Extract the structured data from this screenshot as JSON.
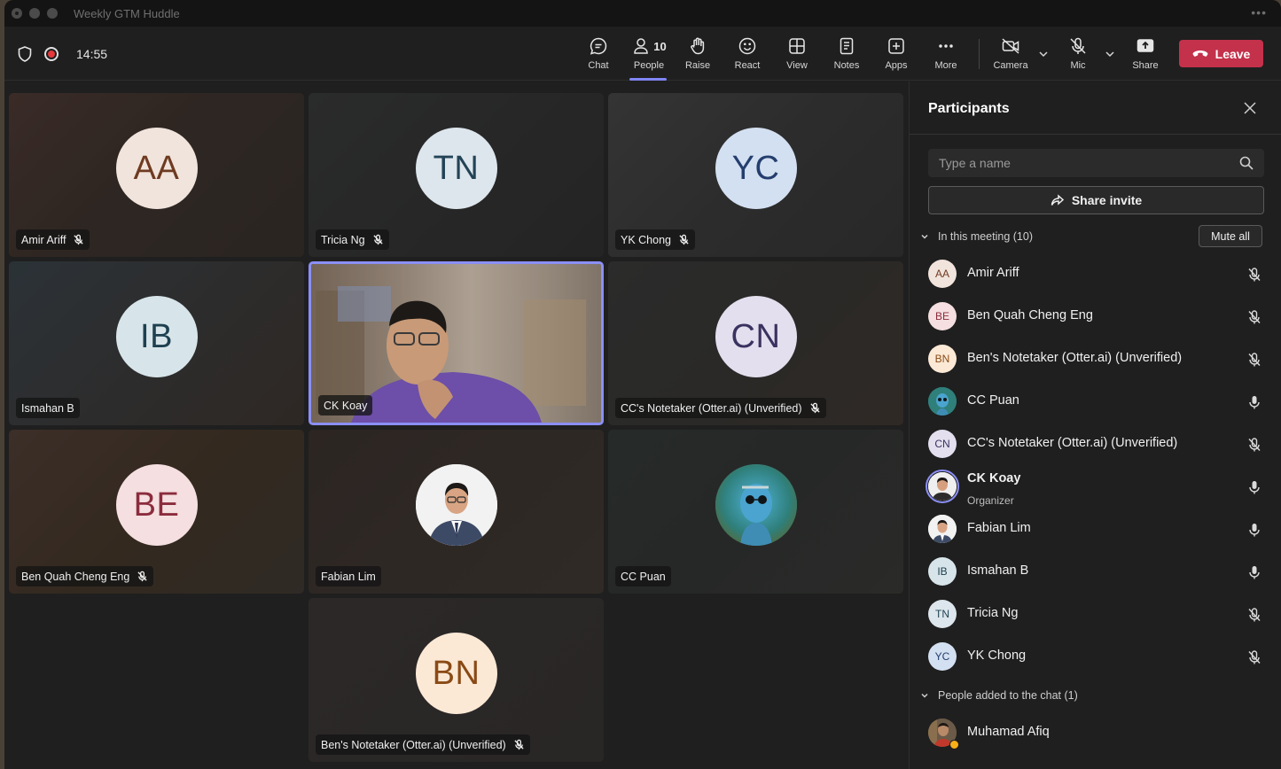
{
  "window": {
    "title": "Weekly GTM Huddle"
  },
  "toolbar": {
    "timer": "14:55",
    "chat_label": "Chat",
    "people_label": "People",
    "people_count": "10",
    "raise_label": "Raise",
    "react_label": "React",
    "view_label": "View",
    "notes_label": "Notes",
    "apps_label": "Apps",
    "more_label": "More",
    "camera_label": "Camera",
    "mic_label": "Mic",
    "share_label": "Share",
    "leave_label": "Leave"
  },
  "grid": {
    "tiles": [
      {
        "initials": "AA",
        "name": "Amir Ariff",
        "muted": true,
        "avatar_bg": "#f1e4dc",
        "avatar_fg": "#6e3b21"
      },
      {
        "initials": "TN",
        "name": "Tricia Ng",
        "muted": true,
        "avatar_bg": "#dde6ec",
        "avatar_fg": "#234356"
      },
      {
        "initials": "YC",
        "name": "YK Chong",
        "muted": true,
        "avatar_bg": "#d3e0f1",
        "avatar_fg": "#243e6e"
      },
      {
        "initials": "IB",
        "name": "Ismahan B",
        "muted": false,
        "avatar_bg": "#d7e5ea",
        "avatar_fg": "#1e4050"
      },
      {
        "initials": "",
        "name": "CK Koay",
        "muted": false,
        "video": true
      },
      {
        "initials": "CN",
        "name": "CC's Notetaker (Otter.ai) (Unverified)",
        "muted": true,
        "avatar_bg": "#e3dfee",
        "avatar_fg": "#3a3260"
      },
      {
        "initials": "BE",
        "name": "Ben Quah Cheng Eng",
        "muted": true,
        "avatar_bg": "#f5dfe0",
        "avatar_fg": "#8b2c3d"
      },
      {
        "initials": "",
        "name": "Fabian Lim",
        "muted": false,
        "photo": "person-photo"
      },
      {
        "initials": "",
        "name": "CC Puan",
        "muted": false,
        "photo": "person-photo"
      },
      {
        "initials": "BN",
        "name": "Ben's Notetaker (Otter.ai) (Unverified)",
        "muted": true,
        "avatar_bg": "#fbe9d6",
        "avatar_fg": "#8a4a15"
      }
    ]
  },
  "panel": {
    "title": "Participants",
    "search_placeholder": "Type a name",
    "share_invite_label": "Share invite",
    "in_meeting_label": "In this meeting (10)",
    "mute_all_label": "Mute all",
    "added_label": "People added to the chat (1)",
    "participants": [
      {
        "initials": "AA",
        "name": "Amir Ariff",
        "mic": "muted",
        "avatar_bg": "#f1e4dc",
        "avatar_fg": "#6e3b21"
      },
      {
        "initials": "BE",
        "name": "Ben Quah Cheng Eng",
        "mic": "muted",
        "avatar_bg": "#f5dfe0",
        "avatar_fg": "#8b2c3d"
      },
      {
        "initials": "BN",
        "name": "Ben's Notetaker (Otter.ai) (Unverified)",
        "mic": "muted",
        "avatar_bg": "#fbe9d6",
        "avatar_fg": "#8a4a15"
      },
      {
        "initials": "",
        "name": "CC Puan",
        "mic": "on",
        "photo": true
      },
      {
        "initials": "CN",
        "name": "CC's Notetaker (Otter.ai) (Unverified)",
        "mic": "muted",
        "avatar_bg": "#e3dfee",
        "avatar_fg": "#3a3260"
      },
      {
        "initials": "",
        "name": "CK Koay",
        "role": "Organizer",
        "mic": "on",
        "photo": true
      },
      {
        "initials": "",
        "name": "Fabian Lim",
        "mic": "on",
        "photo": true
      },
      {
        "initials": "IB",
        "name": "Ismahan B",
        "mic": "on",
        "avatar_bg": "#d7e5ea",
        "avatar_fg": "#1e4050"
      },
      {
        "initials": "TN",
        "name": "Tricia Ng",
        "mic": "muted",
        "avatar_bg": "#dde6ec",
        "avatar_fg": "#234356"
      },
      {
        "initials": "YC",
        "name": "YK Chong",
        "mic": "muted",
        "avatar_bg": "#d3e0f1",
        "avatar_fg": "#243e6e"
      }
    ],
    "added": [
      {
        "name": "Muhamad Afiq",
        "photo": true,
        "status": "away"
      }
    ]
  },
  "colors": {
    "accent": "#7f85f5",
    "leave": "#c4314b"
  }
}
